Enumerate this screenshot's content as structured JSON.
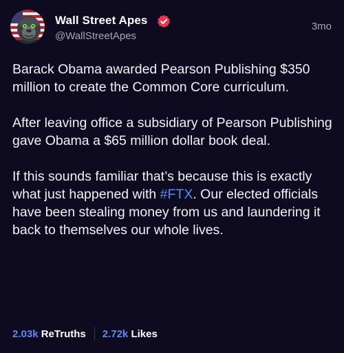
{
  "post": {
    "author": {
      "display_name": "Wall Street Apes",
      "handle": "@WallStreetApes",
      "verified": true,
      "avatar_icon": "gorilla-flag-avatar"
    },
    "timestamp": "3mo",
    "paragraphs": [
      {
        "text": "Barack Obama awarded Pearson Publishing $350 million to create the Common Core curriculum."
      },
      {
        "text": "After leaving office a subsidiary of Pearson Publishing gave Obama a $65 million dollar book deal."
      },
      {
        "before": "If this sounds familiar that’s because this is exactly what just happened with ",
        "hashtag": "#FTX",
        "after": ". Our elected officials have been stealing money from us and laundering it back to themselves our whole lives."
      }
    ],
    "stats": {
      "retruths_count": "2.03k",
      "retruths_label": "ReTruths",
      "likes_count": "2.72k",
      "likes_label": "Likes"
    }
  },
  "colors": {
    "background": "#0e0b20",
    "accent": "#5b8cf5",
    "verified_badge": "#e8384f",
    "muted_text": "#a8a6b8"
  }
}
